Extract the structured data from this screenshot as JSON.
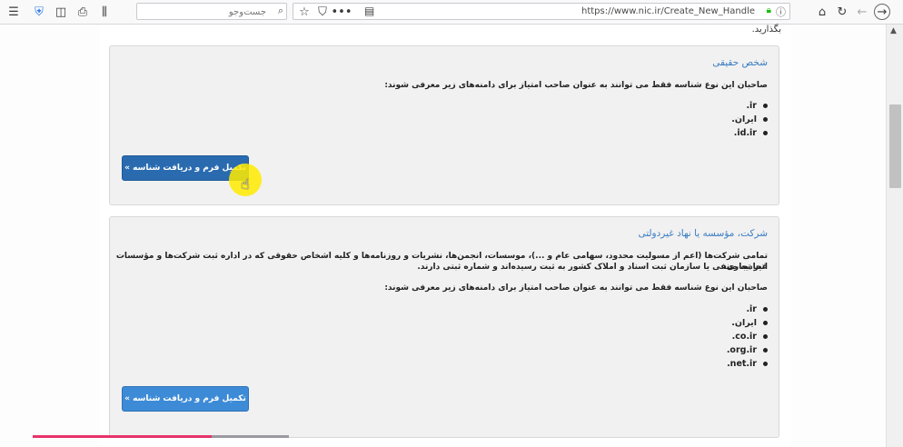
{
  "browser": {
    "search_placeholder": "جست‌وجو",
    "url": "https://www.nic.ir/Create_New_Handle",
    "icons": [
      "menu-icon",
      "shield-icon",
      "sidebar-icon",
      "print-icon",
      "library-icon",
      "search-icon",
      "reader-icon",
      "more-icon",
      "pocket-icon",
      "star-icon",
      "home-icon",
      "reload-icon",
      "back-icon",
      "forward-icon",
      "lock-icon",
      "info-icon"
    ]
  },
  "page": {
    "top_text": "بگذارید.",
    "panels": [
      {
        "title": "شخص حقیقی",
        "text": "صاحبان این نوع شناسه فقط می توانند به عنوان صاحب امتیاز برای دامنه‌های زیر معرفی شوند:",
        "domains": [
          ".ir",
          ".ایران",
          ".id.ir"
        ],
        "button": "تکمیل فرم و دریافت شناسه »"
      },
      {
        "title": "شرکت، مؤسسه یا نهاد غیردولتی",
        "desc1": "تمامی شرکت‌ها (اعم از مسولیت محدود، سهامی عام و ...)، موسسات، انجمن‌ها، نشریات و روزنامه‌ها و کلیه اشخاص حقوقی که در اداره ثبت شرکت‌ها و مؤسسات غیر تجاری،",
        "desc2": "اتحادیه صنفی یا سازمان ثبت اسناد و املاک کشور به ثبت رسیده‌اند و شماره ثبتی دارند.",
        "text": "صاحبان این نوع شناسه فقط می توانند به عنوان صاحب امتیاز برای دامنه‌های زیر معرفی شوند:",
        "domains": [
          ".ir",
          ".ایران",
          ".co.ir",
          ".org.ir",
          ".net.ir"
        ],
        "button": "تکمیل فرم و دریافت شناسه »"
      }
    ]
  },
  "video_progress": 0.7,
  "colors": {
    "accent": "#3d8bd6",
    "title": "#3a7cc2",
    "progress": "#e8336a"
  }
}
